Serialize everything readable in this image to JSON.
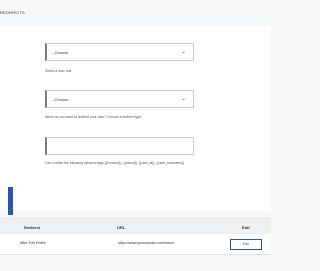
{
  "section": {
    "title": "REDIRECTS"
  },
  "role_select": {
    "value": "--Choose",
    "help": "Select a user role."
  },
  "type_select": {
    "value": "--Choose",
    "help": "When do you want to redirect your user? Choose a redirect type."
  },
  "url_field": {
    "value": "",
    "help": "Can contain the following dynamic tags:{{homeurl}}, {{siteurl}}, {{user_id}}, {{user_nicename}}"
  },
  "table": {
    "headers": {
      "redirect": "Redirect",
      "url": "URL",
      "edit": "Edit"
    },
    "rows": [
      {
        "redirect": "After Edit Profile",
        "url": "https://www.yourdomain.com/forum",
        "edit": "Edit"
      }
    ]
  },
  "icons": {
    "chevron": "chevron-down-icon"
  }
}
